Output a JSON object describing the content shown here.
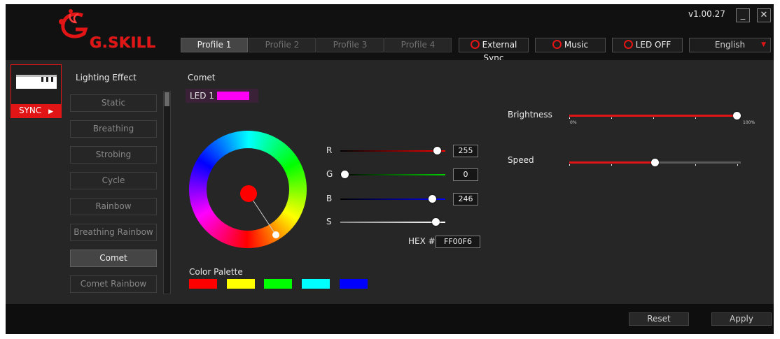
{
  "titlebar": {
    "logo_text": "G.SKILL",
    "version": "v1.00.27",
    "minimize_label": "_",
    "close_label": "✕"
  },
  "profiles": [
    {
      "label": "Profile 1",
      "active": true
    },
    {
      "label": "Profile 2",
      "active": false
    },
    {
      "label": "Profile 3",
      "active": false
    },
    {
      "label": "Profile 4",
      "active": false
    }
  ],
  "controls": {
    "external_sync": "External Sync",
    "music": "Music",
    "led_off": "LED OFF",
    "language": "English"
  },
  "sync": {
    "label": "SYNC"
  },
  "lighting": {
    "heading": "Lighting Effect",
    "effects": [
      "Static",
      "Breathing",
      "Strobing",
      "Cycle",
      "Rainbow",
      "Breathing Rainbow",
      "Comet",
      "Comet Rainbow"
    ],
    "selected": "Comet"
  },
  "effect_panel": {
    "title": "Comet",
    "led_label": "LED 1",
    "led_color": "#ff00f6"
  },
  "rgb": {
    "r_label": "R",
    "r_value": "255",
    "g_label": "G",
    "g_value": "0",
    "b_label": "B",
    "b_value": "246",
    "s_label": "S",
    "hex_label": "HEX #",
    "hex_value": "FF00F6"
  },
  "palette": {
    "heading": "Color Palette",
    "colors": [
      "#ff0000",
      "#ffff00",
      "#00ff00",
      "#00ffff",
      "#0000ff"
    ]
  },
  "brightness": {
    "label": "Brightness",
    "min_label": "0%",
    "max_label": "100%",
    "value_percent": 100
  },
  "speed": {
    "label": "Speed",
    "value_percent": 50
  },
  "footer": {
    "reset": "Reset",
    "apply": "Apply"
  },
  "colors": {
    "accent": "#e11515",
    "background": "#242424",
    "titlebar": "#111111"
  }
}
